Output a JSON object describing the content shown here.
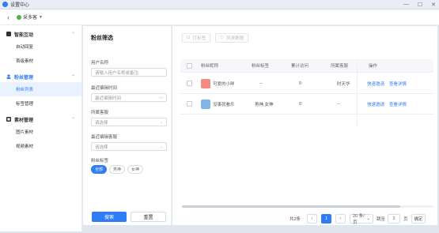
{
  "window": {
    "title": "设置中心",
    "controls": [
      "—",
      "☐",
      "✕"
    ]
  },
  "header": {
    "account_name": "采多客"
  },
  "sidebar": {
    "groups": [
      {
        "label": "智能互动",
        "items": [
          "自动回复",
          "首级素材"
        ]
      },
      {
        "label": "粉丝管理",
        "items": [
          "粉丝列表",
          "标签管理"
        ]
      },
      {
        "label": "素材管理",
        "items": [
          "图片素材",
          "视频素材"
        ]
      }
    ]
  },
  "filter": {
    "title": "粉丝筛选",
    "fields": [
      {
        "label": "用户名称",
        "placeholder": "请输入用户名称或备注"
      },
      {
        "label": "最近编辑时间",
        "placeholder": "最近编辑时间"
      },
      {
        "label": "所属客服",
        "placeholder": "请选择"
      },
      {
        "label": "最近编辑客服",
        "placeholder": "请选择"
      }
    ],
    "tags_label": "粉丝标签",
    "tags": [
      "全部",
      "男神",
      "女神"
    ],
    "search_label": "搜索",
    "reset_label": "重置"
  },
  "toolbar": {
    "tag_label": "打标签",
    "remove_label": "风清数据"
  },
  "table": {
    "headers": [
      "粉丝昵称",
      "粉丝标签",
      "累计访问",
      "所属客服",
      "操作"
    ],
    "rows": [
      {
        "nickname": "可爱的小咩",
        "tags": "--",
        "visits": "0",
        "agent": "时天华",
        "avatar_color": "#f28b82"
      },
      {
        "nickname": "没事就看乐",
        "tags": "男神,女神",
        "visits": "0",
        "agent": "--",
        "avatar_color": "#7fb8e6"
      }
    ],
    "actions": [
      "快速邀请",
      "查看详情"
    ]
  },
  "pagination": {
    "total": "共2条",
    "current_page": "1",
    "page_size": "20 条/页",
    "jump_label": "跳至",
    "jump_value": "1",
    "page_suffix": "页",
    "confirm_label": "确定"
  }
}
